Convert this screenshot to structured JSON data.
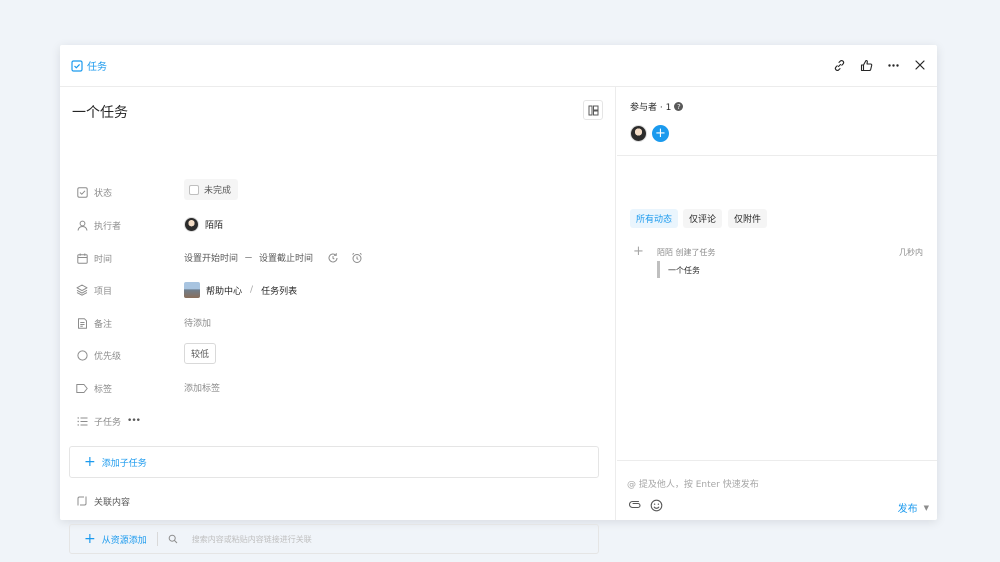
{
  "header": {
    "crumb_label": "任务",
    "actions": [
      "link-icon",
      "thumbs-up-icon",
      "more-icon",
      "close-icon"
    ]
  },
  "task": {
    "title": "一个任务",
    "fields": {
      "status": {
        "label": "状态",
        "value": "未完成"
      },
      "assignee": {
        "label": "执行者",
        "value": "陌陌"
      },
      "time": {
        "label": "时间",
        "start": "设置开始时间",
        "dash": "－",
        "end": "设置截止时间"
      },
      "project": {
        "label": "项目",
        "name": "帮助中心",
        "slash": "/",
        "list": "任务列表"
      },
      "note": {
        "label": "备注",
        "value": "待添加"
      },
      "priority": {
        "label": "优先级",
        "value": "较低"
      },
      "tags": {
        "label": "标签",
        "value": "添加标签"
      },
      "subtasks": {
        "label": "子任务",
        "more": "•••"
      }
    },
    "add_subtask": "添加子任务",
    "related_label": "关联内容",
    "add_from_resource": "从资源添加",
    "search_placeholder": "搜索内容或粘贴内容链接进行关联"
  },
  "participants": {
    "title": "参与者 · 1",
    "help": "?"
  },
  "activity_tabs": [
    "所有动态",
    "仅评论",
    "仅附件"
  ],
  "activity": {
    "text": "陌陌 创建了任务",
    "time": "几秒内",
    "quote": "一个任务"
  },
  "comment": {
    "placeholder": "@ 提及他人，按 Enter 快速发布",
    "publish": "发布"
  },
  "colors": {
    "accent": "#1b9aee",
    "background": "#f0f4f9"
  }
}
